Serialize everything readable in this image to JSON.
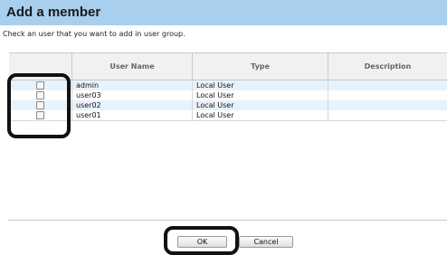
{
  "dialog": {
    "title": "Add a member",
    "instruction": "Check an user that you want to add in user group."
  },
  "table": {
    "columns": [
      "",
      "User Name",
      "Type",
      "Description"
    ],
    "rows": [
      {
        "checked": false,
        "user_name": "admin",
        "type": "Local User",
        "description": ""
      },
      {
        "checked": false,
        "user_name": "user03",
        "type": "Local User",
        "description": ""
      },
      {
        "checked": false,
        "user_name": "user02",
        "type": "Local User",
        "description": ""
      },
      {
        "checked": false,
        "user_name": "user01",
        "type": "Local User",
        "description": ""
      }
    ]
  },
  "buttons": {
    "ok_label": "OK",
    "cancel_label": "Cancel"
  },
  "colors": {
    "header_bg": "#a8cfee",
    "row_alt_bg": "#e8f2fb",
    "highlight": "#111111"
  }
}
